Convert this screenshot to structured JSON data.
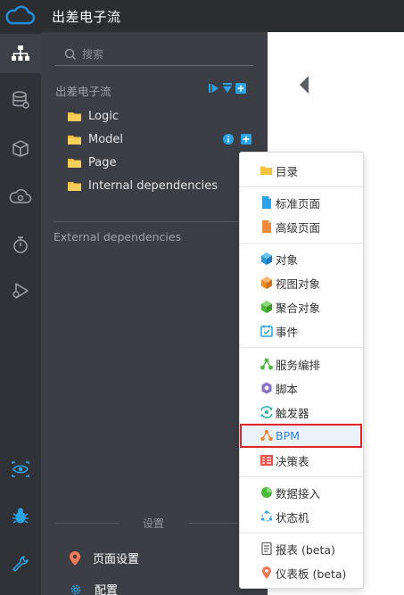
{
  "app": {
    "title": "出差电子流"
  },
  "search": {
    "placeholder": "搜索"
  },
  "tree": {
    "section_title": "出差电子流",
    "items": [
      {
        "label": "Logic"
      },
      {
        "label": "Model"
      },
      {
        "label": "Page"
      },
      {
        "label": "Internal dependencies"
      }
    ],
    "external_title": "External dependencies"
  },
  "settings": {
    "section_label": "设置",
    "items": [
      {
        "label": "页面设置"
      },
      {
        "label": "配置"
      }
    ]
  },
  "menu": {
    "groups": [
      [
        {
          "label": "目录",
          "icon": "folder-icon"
        }
      ],
      [
        {
          "label": "标准页面",
          "icon": "page-icon"
        },
        {
          "label": "高级页面",
          "icon": "page-orange-icon"
        }
      ],
      [
        {
          "label": "对象",
          "icon": "cube-icon"
        },
        {
          "label": "视图对象",
          "icon": "cube-orange-icon"
        },
        {
          "label": "聚合对象",
          "icon": "cube-green-icon"
        },
        {
          "label": "事件",
          "icon": "event-icon"
        }
      ],
      [
        {
          "label": "服务编排",
          "icon": "flow-icon"
        },
        {
          "label": "脚本",
          "icon": "script-icon"
        },
        {
          "label": "触发器",
          "icon": "trigger-icon"
        },
        {
          "label": "BPM",
          "icon": "bpm-icon"
        },
        {
          "label": "决策表",
          "icon": "table-icon"
        }
      ],
      [
        {
          "label": "数据接入",
          "icon": "pie-icon"
        },
        {
          "label": "状态机",
          "icon": "state-icon"
        }
      ],
      [
        {
          "label": "报表 (beta)",
          "icon": "report-icon"
        },
        {
          "label": "仪表板 (beta)",
          "icon": "pin-icon"
        }
      ]
    ]
  },
  "colors": {
    "accent": "#1e8fe1",
    "highlight_border": "#e0232b",
    "folder": "#f5c243"
  }
}
